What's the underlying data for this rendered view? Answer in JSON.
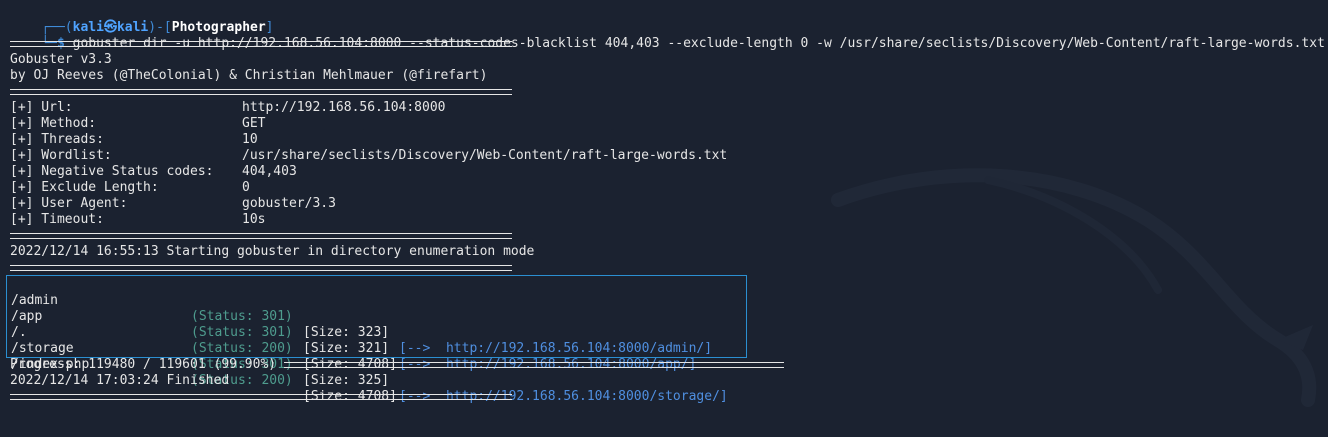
{
  "prompt": {
    "user_host_open": "┌──(",
    "user": "kali",
    "at": "㉿",
    "host": "kali",
    "dir_open": ")-[",
    "dir": "Photographer",
    "dir_close": "]",
    "line2_prefix": "└─$",
    "command": "gobuster dir -u http://192.168.56.104:8000 --status-codes-blacklist 404,403 --exclude-length 0 -w /usr/share/seclists/Discovery/Web-Content/raft-large-words.txt"
  },
  "banner": {
    "version": "Gobuster v3.3",
    "authors": "by OJ Reeves (@TheColonial) & Christian Mehlmauer (@firefart)"
  },
  "config": [
    {
      "label": "[+] Url:",
      "value": "http://192.168.56.104:8000"
    },
    {
      "label": "[+] Method:",
      "value": "GET"
    },
    {
      "label": "[+] Threads:",
      "value": "10"
    },
    {
      "label": "[+] Wordlist:",
      "value": "/usr/share/seclists/Discovery/Web-Content/raft-large-words.txt"
    },
    {
      "label": "[+] Negative Status codes:",
      "value": "404,403"
    },
    {
      "label": "[+] Exclude Length:",
      "value": "0"
    },
    {
      "label": "[+] User Agent:",
      "value": "gobuster/3.3"
    },
    {
      "label": "[+] Timeout:",
      "value": "10s"
    }
  ],
  "start_line": "2022/12/14 16:55:13 Starting gobuster in directory enumeration mode",
  "results": [
    {
      "path": "/admin",
      "status": "(Status: 301)",
      "size": "[Size: 323]",
      "redirect": "[-->  http://192.168.56.104:8000/admin/]"
    },
    {
      "path": "/app",
      "status": "(Status: 301)",
      "size": "[Size: 321]",
      "redirect": "[-->  http://192.168.56.104:8000/app/]"
    },
    {
      "path": "/.",
      "status": "(Status: 200)",
      "size": "[Size: 4708]",
      "redirect": ""
    },
    {
      "path": "/storage",
      "status": "(Status: 301)",
      "size": "[Size: 325]",
      "redirect": "[-->  http://192.168.56.104:8000/storage/]"
    },
    {
      "path": "/index-php",
      "status": "(Status: 200)",
      "size": "[Size: 4708]",
      "redirect": ""
    }
  ],
  "progress": "Progress: 119480 / 119601 (99.90%)",
  "finished": "2022/12/14 17:03:24 Finished",
  "colors": {
    "background": "#1b2230",
    "prompt_blue": "#4fa3ff",
    "status_teal": "#4e9c8e",
    "redirect_blue": "#4f8fe0",
    "box_border": "#2b8fd1"
  }
}
